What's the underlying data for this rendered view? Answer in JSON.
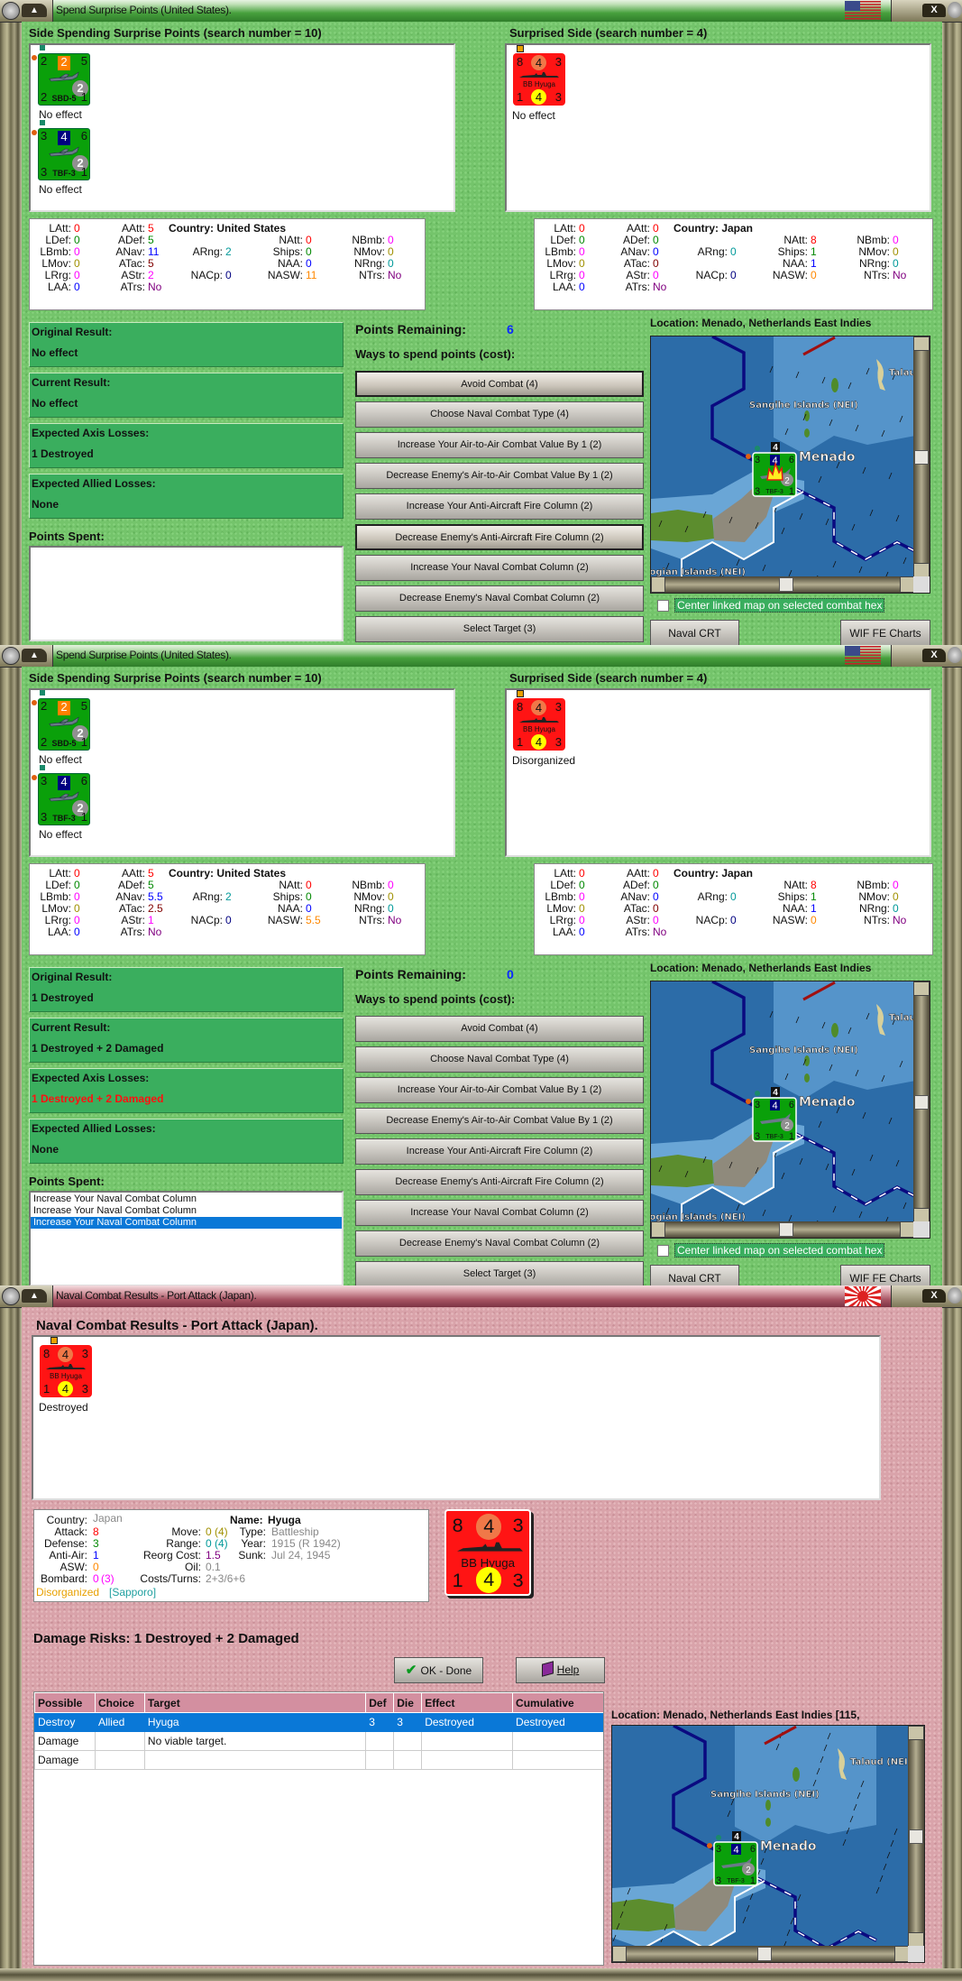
{
  "colors": {
    "red": "#ff0000",
    "green": "#008800",
    "magenta": "#ff00ff",
    "olive": "#a09000",
    "blue": "#0000ff",
    "maroon": "#800000",
    "purple": "#800080",
    "teal": "#009999",
    "navy": "#000080",
    "orange": "#ff8800",
    "gray": "#888888"
  },
  "spend_windows": [
    {
      "title": "Spend Surprise Points (United States).",
      "flag_icon": "us-flag-icon",
      "left_header": "Side Spending Surprise Points (search number = 10)",
      "right_header": "Surprised Side (search number = 4)",
      "left_units": [
        {
          "type": "air",
          "tl": "2",
          "tm": "2",
          "tm_color": "#ff8000",
          "tr": "5",
          "circle": "2",
          "bl": "2",
          "name": "SBD-5",
          "br": "1",
          "status": "No effect"
        },
        {
          "type": "air",
          "tl": "3",
          "tm": "4",
          "tm_color": "#000080",
          "tr": "6",
          "circle": "2",
          "bl": "3",
          "name": "TBF-3",
          "br": "1",
          "status": "No effect"
        }
      ],
      "right_units": [
        {
          "type": "ship",
          "tl": "8",
          "tm": "4",
          "tr": "3",
          "name": "BB Hyuga",
          "bl": "1",
          "bm": "4",
          "br": "3",
          "status": "No effect"
        }
      ],
      "left_stats": {
        "country": "Country: United States",
        "items": [
          {
            "label": "LAtt:",
            "value": "0",
            "color": "#ff0000"
          },
          {
            "label": "LDef:",
            "value": "0",
            "color": "#008800"
          },
          {
            "label": "LBmb:",
            "value": "0",
            "color": "#ff00ff"
          },
          {
            "label": "LMov:",
            "value": "0",
            "color": "#a09000"
          },
          {
            "label": "LRrg:",
            "value": "0",
            "color": "#ff00ff"
          },
          {
            "label": "LAA:",
            "value": "0",
            "color": "#0000ff"
          },
          {
            "label": "AAtt:",
            "value": "5",
            "color": "#ff0000"
          },
          {
            "label": "ADef:",
            "value": "5",
            "color": "#008800"
          },
          {
            "label": "ANav:",
            "value": "11",
            "color": "#0000ff"
          },
          {
            "label": "ATac:",
            "value": "5",
            "color": "#800000"
          },
          {
            "label": "AStr:",
            "value": "2",
            "color": "#ff00ff"
          },
          {
            "label": "ATrs:",
            "value": "No",
            "color": "#800080"
          },
          {
            "label": "ARng:",
            "value": "2",
            "color": "#009999"
          },
          {
            "label": "NACp:",
            "value": "0",
            "color": "#000080"
          },
          {
            "label": "NAtt:",
            "value": "0",
            "color": "#ff0000"
          },
          {
            "label": "Ships:",
            "value": "0",
            "color": "#008800"
          },
          {
            "label": "NAA:",
            "value": "0",
            "color": "#0000ff"
          },
          {
            "label": "NASW:",
            "value": "11",
            "color": "#ff8800"
          },
          {
            "label": "NBmb:",
            "value": "0",
            "color": "#ff00ff"
          },
          {
            "label": "NMov:",
            "value": "0",
            "color": "#a09000"
          },
          {
            "label": "NRng:",
            "value": "0",
            "color": "#009999"
          },
          {
            "label": "NTrs:",
            "value": "No",
            "color": "#800080"
          }
        ]
      },
      "right_stats": {
        "country": "Country: Japan",
        "items": [
          {
            "label": "LAtt:",
            "value": "0",
            "color": "#ff0000"
          },
          {
            "label": "LDef:",
            "value": "0",
            "color": "#008800"
          },
          {
            "label": "LBmb:",
            "value": "0",
            "color": "#ff00ff"
          },
          {
            "label": "LMov:",
            "value": "0",
            "color": "#a09000"
          },
          {
            "label": "LRrg:",
            "value": "0",
            "color": "#ff00ff"
          },
          {
            "label": "LAA:",
            "value": "0",
            "color": "#0000ff"
          },
          {
            "label": "AAtt:",
            "value": "0",
            "color": "#ff0000"
          },
          {
            "label": "ADef:",
            "value": "0",
            "color": "#008800"
          },
          {
            "label": "ANav:",
            "value": "0",
            "color": "#0000ff"
          },
          {
            "label": "ATac:",
            "value": "0",
            "color": "#800000"
          },
          {
            "label": "AStr:",
            "value": "0",
            "color": "#ff00ff"
          },
          {
            "label": "ATrs:",
            "value": "No",
            "color": "#800080"
          },
          {
            "label": "ARng:",
            "value": "0",
            "color": "#009999"
          },
          {
            "label": "NACp:",
            "value": "0",
            "color": "#000080"
          },
          {
            "label": "NAtt:",
            "value": "8",
            "color": "#ff0000"
          },
          {
            "label": "Ships:",
            "value": "1",
            "color": "#008800"
          },
          {
            "label": "NAA:",
            "value": "1",
            "color": "#0000ff"
          },
          {
            "label": "NASW:",
            "value": "0",
            "color": "#ff8800"
          },
          {
            "label": "NBmb:",
            "value": "0",
            "color": "#ff00ff"
          },
          {
            "label": "NMov:",
            "value": "0",
            "color": "#a09000"
          },
          {
            "label": "NRng:",
            "value": "0",
            "color": "#009999"
          },
          {
            "label": "NTrs:",
            "value": "No",
            "color": "#800080"
          }
        ]
      },
      "results": [
        {
          "label": "Original Result:",
          "value": "No effect",
          "color": "#111111"
        },
        {
          "label": "Current Result:",
          "value": "No effect",
          "color": "#111111"
        },
        {
          "label": "Expected Axis Losses:",
          "value": "1 Destroyed",
          "color": "#111111"
        },
        {
          "label": "Expected Allied Losses:",
          "value": "None",
          "color": "#111111"
        }
      ],
      "points_remaining_label": "Points Remaining:",
      "points_remaining": "6",
      "ways_label": "Ways to spend points (cost):",
      "buttons": [
        "Avoid Combat (4)",
        "Choose Naval Combat Type (4)",
        "Increase Your Air-to-Air Combat Value By 1 (2)",
        "Decrease Enemy's Air-to-Air Combat Value By 1 (2)",
        "Increase Your Anti-Aircraft Fire Column (2)",
        "Decrease Enemy's Anti-Aircraft Fire Column (2)",
        "Increase Your Naval Combat Column (2)",
        "Decrease Enemy's Naval Combat Column (2)",
        "Select Target (3)"
      ],
      "highlighted_buttons": [
        0,
        5
      ],
      "points_spent_label": "Points Spent:",
      "points_spent": [],
      "selected_spent": -1,
      "location": "Location: Menado, Netherlands East Indies",
      "map": {
        "islands": "Sangihe Islands (NEI)",
        "city": "Menado",
        "north": "Talaud (NEI)",
        "south": "Togian Islands (NEI)",
        "stack": "4",
        "unit": {
          "tl": "3",
          "tm": "4",
          "tr": "6",
          "circle": "2",
          "bl": "3",
          "name": "TBF-3",
          "br": "1"
        },
        "fire": true
      },
      "center_checkbox_label": "Center linked map on selected combat hex",
      "center_checked": false,
      "naval_crt": "Naval CRT",
      "charts": "WIF FE Charts"
    },
    {
      "title": "Spend Surprise Points (United States).",
      "flag_icon": "us-flag-icon",
      "left_header": "Side Spending Surprise Points (search number = 10)",
      "right_header": "Surprised Side (search number = 4)",
      "left_units": [
        {
          "type": "air",
          "tl": "2",
          "tm": "2",
          "tm_color": "#ff8000",
          "tr": "5",
          "circle": "2",
          "bl": "2",
          "name": "SBD-5",
          "br": "1",
          "status": "No effect"
        },
        {
          "type": "air",
          "tl": "3",
          "tm": "4",
          "tm_color": "#000080",
          "tr": "6",
          "circle": "2",
          "bl": "3",
          "name": "TBF-3",
          "br": "1",
          "status": "No effect"
        }
      ],
      "right_units": [
        {
          "type": "ship",
          "tl": "8",
          "tm": "4",
          "tr": "3",
          "name": "BB Hyuga",
          "bl": "1",
          "bm": "4",
          "br": "3",
          "status": "Disorganized"
        }
      ],
      "left_stats": {
        "country": "Country: United States",
        "items": [
          {
            "label": "LAtt:",
            "value": "0",
            "color": "#ff0000"
          },
          {
            "label": "LDef:",
            "value": "0",
            "color": "#008800"
          },
          {
            "label": "LBmb:",
            "value": "0",
            "color": "#ff00ff"
          },
          {
            "label": "LMov:",
            "value": "0",
            "color": "#a09000"
          },
          {
            "label": "LRrg:",
            "value": "0",
            "color": "#ff00ff"
          },
          {
            "label": "LAA:",
            "value": "0",
            "color": "#0000ff"
          },
          {
            "label": "AAtt:",
            "value": "5",
            "color": "#ff0000"
          },
          {
            "label": "ADef:",
            "value": "5",
            "color": "#008800"
          },
          {
            "label": "ANav:",
            "value": "5.5",
            "color": "#0000ff"
          },
          {
            "label": "ATac:",
            "value": "2.5",
            "color": "#800000"
          },
          {
            "label": "AStr:",
            "value": "1",
            "color": "#ff00ff"
          },
          {
            "label": "ATrs:",
            "value": "No",
            "color": "#800080"
          },
          {
            "label": "ARng:",
            "value": "2",
            "color": "#009999"
          },
          {
            "label": "NACp:",
            "value": "0",
            "color": "#000080"
          },
          {
            "label": "NAtt:",
            "value": "0",
            "color": "#ff0000"
          },
          {
            "label": "Ships:",
            "value": "0",
            "color": "#008800"
          },
          {
            "label": "NAA:",
            "value": "0",
            "color": "#0000ff"
          },
          {
            "label": "NASW:",
            "value": "5.5",
            "color": "#ff8800"
          },
          {
            "label": "NBmb:",
            "value": "0",
            "color": "#ff00ff"
          },
          {
            "label": "NMov:",
            "value": "0",
            "color": "#a09000"
          },
          {
            "label": "NRng:",
            "value": "0",
            "color": "#009999"
          },
          {
            "label": "NTrs:",
            "value": "No",
            "color": "#800080"
          }
        ]
      },
      "right_stats": {
        "country": "Country: Japan",
        "items": [
          {
            "label": "LAtt:",
            "value": "0",
            "color": "#ff0000"
          },
          {
            "label": "LDef:",
            "value": "0",
            "color": "#008800"
          },
          {
            "label": "LBmb:",
            "value": "0",
            "color": "#ff00ff"
          },
          {
            "label": "LMov:",
            "value": "0",
            "color": "#a09000"
          },
          {
            "label": "LRrg:",
            "value": "0",
            "color": "#ff00ff"
          },
          {
            "label": "LAA:",
            "value": "0",
            "color": "#0000ff"
          },
          {
            "label": "AAtt:",
            "value": "0",
            "color": "#ff0000"
          },
          {
            "label": "ADef:",
            "value": "0",
            "color": "#008800"
          },
          {
            "label": "ANav:",
            "value": "0",
            "color": "#0000ff"
          },
          {
            "label": "ATac:",
            "value": "0",
            "color": "#800000"
          },
          {
            "label": "AStr:",
            "value": "0",
            "color": "#ff00ff"
          },
          {
            "label": "ATrs:",
            "value": "No",
            "color": "#800080"
          },
          {
            "label": "ARng:",
            "value": "0",
            "color": "#009999"
          },
          {
            "label": "NACp:",
            "value": "0",
            "color": "#000080"
          },
          {
            "label": "NAtt:",
            "value": "8",
            "color": "#ff0000"
          },
          {
            "label": "Ships:",
            "value": "1",
            "color": "#008800"
          },
          {
            "label": "NAA:",
            "value": "1",
            "color": "#0000ff"
          },
          {
            "label": "NASW:",
            "value": "0",
            "color": "#ff8800"
          },
          {
            "label": "NBmb:",
            "value": "0",
            "color": "#ff00ff"
          },
          {
            "label": "NMov:",
            "value": "0",
            "color": "#a09000"
          },
          {
            "label": "NRng:",
            "value": "0",
            "color": "#009999"
          },
          {
            "label": "NTrs:",
            "value": "No",
            "color": "#800080"
          }
        ]
      },
      "results": [
        {
          "label": "Original Result:",
          "value": "1 Destroyed",
          "color": "#111111"
        },
        {
          "label": "Current Result:",
          "value": "1 Destroyed + 2 Damaged",
          "color": "#111111"
        },
        {
          "label": "Expected Axis Losses:",
          "value": "1 Destroyed + 2 Damaged",
          "color": "#ff1010"
        },
        {
          "label": "Expected Allied Losses:",
          "value": "None",
          "color": "#111111"
        }
      ],
      "points_remaining_label": "Points Remaining:",
      "points_remaining": "0",
      "ways_label": "Ways to spend points (cost):",
      "buttons": [
        "Avoid Combat (4)",
        "Choose Naval Combat Type (4)",
        "Increase Your Air-to-Air Combat Value By 1 (2)",
        "Decrease Enemy's Air-to-Air Combat Value By 1 (2)",
        "Increase Your Anti-Aircraft Fire Column (2)",
        "Decrease Enemy's Anti-Aircraft Fire Column (2)",
        "Increase Your Naval Combat Column (2)",
        "Decrease Enemy's Naval Combat Column (2)",
        "Select Target (3)"
      ],
      "highlighted_buttons": [],
      "points_spent_label": "Points Spent:",
      "points_spent": [
        "Increase Your Naval Combat Column",
        "Increase Your Naval Combat Column",
        "Increase Your Naval Combat Column"
      ],
      "selected_spent": 2,
      "location": "Location: Menado, Netherlands East Indies",
      "map": {
        "islands": "Sangihe Islands (NEI)",
        "city": "Menado",
        "north": "Talaud (NEI)",
        "south": "Togian Islands (NEI)",
        "stack": "4",
        "unit": {
          "tl": "3",
          "tm": "4",
          "tr": "6",
          "circle": "2",
          "bl": "3",
          "name": "TBF-3",
          "br": "1"
        },
        "fire": false
      },
      "center_checkbox_label": "Center linked map on selected combat hex",
      "center_checked": false,
      "naval_crt": "Naval CRT",
      "charts": "WIF FE Charts"
    }
  ],
  "results_window": {
    "title": "Naval Combat Results - Port Attack (Japan).",
    "flag_icon": "japan-rising-sun-flag-icon",
    "header": "Naval Combat Results - Port Attack (Japan).",
    "unit": {
      "type": "ship",
      "tl": "8",
      "tm": "4",
      "tr": "3",
      "name": "BB Hyuga",
      "bl": "1",
      "bm": "4",
      "br": "3",
      "status": "Destroyed"
    },
    "info": {
      "country_label": "Country:",
      "country": "Japan",
      "attack_label": "Attack:",
      "attack": "8",
      "defense_label": "Defense:",
      "defense": "3",
      "antiair_label": "Anti-Air:",
      "antiair": "1",
      "asw_label": "ASW:",
      "asw": "0",
      "bombard_label": "Bombard:",
      "bombard": "0",
      "bombard_paren": "(3)",
      "name_label": "Name:",
      "name": "Hyuga",
      "move_label": "Move:",
      "move": "0",
      "move_paren": "(4)",
      "range_label": "Range:",
      "range": "0",
      "range_paren": "(4)",
      "reorg_label": "Reorg Cost:",
      "reorg": "1.5",
      "oil_label": "Oil:",
      "oil": "0.1",
      "costs_label": "Costs/Turns:",
      "costs": "2+3/6+6",
      "type_label": "Type:",
      "type": "Battleship",
      "year_label": "Year:",
      "year": "1915 (R 1942)",
      "sunk_label": "Sunk:",
      "sunk": "Jul 24, 1945",
      "state": "Disorganized",
      "port": "[Sapporo]"
    },
    "damage_risks": "Damage Risks:  1 Destroyed + 2 Damaged",
    "ok_label": "OK - Done",
    "help_label": "Help",
    "table": {
      "columns": [
        "Possible",
        "Choice",
        "Target",
        "Def",
        "Die",
        "Effect",
        "Cumulative"
      ],
      "rows": [
        [
          "Destroy",
          "Allied",
          "Hyuga",
          "3",
          "3",
          "Destroyed",
          "Destroyed"
        ],
        [
          "Damage",
          "",
          "No viable target.",
          "",
          "",
          "",
          ""
        ],
        [
          "Damage",
          "",
          "",
          "",
          "",
          "",
          ""
        ]
      ],
      "selected_row": 0
    },
    "location": "Location:  Menado, Netherlands East Indies [115,",
    "map": {
      "islands": "Sangihe Islands (NEI)",
      "city": "Menado",
      "north": "Talaud (NEI)",
      "south": "Togian Islands (NEI)",
      "stack": "4",
      "unit": {
        "tl": "3",
        "tm": "4",
        "tr": "6",
        "circle": "2",
        "bl": "3",
        "name": "TBF-3",
        "br": "1"
      },
      "fire": false
    },
    "center_checkbox_label": "Center linked map on selected combat hex",
    "center_checked": false
  }
}
